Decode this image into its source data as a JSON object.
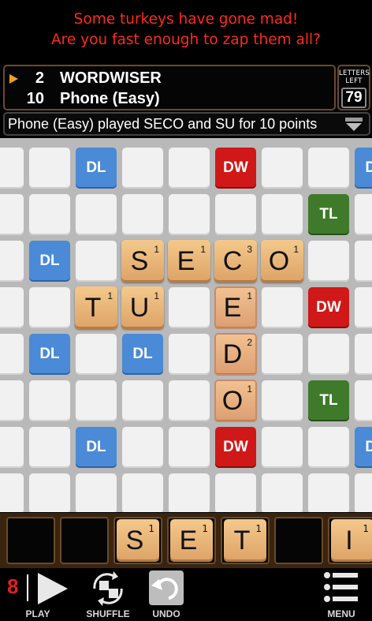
{
  "ad": {
    "line1": "Some turkeys have gone mad!",
    "line2": "Are you fast enough to zap them all?",
    "color": "#ff2a1a"
  },
  "players": [
    {
      "score": "2",
      "name": "WORDWISER",
      "active": true
    },
    {
      "score": "10",
      "name": "Phone (Easy)",
      "active": false
    }
  ],
  "letters_left": {
    "label": "LETTERS LEFT",
    "value": "79"
  },
  "last_move": "Phone (Easy) played SECO and SU for 10 points",
  "board": {
    "bonuses": [
      {
        "type": "DL",
        "col": 2,
        "row": 0
      },
      {
        "type": "DW",
        "col": 5,
        "row": 0
      },
      {
        "type": "DL",
        "col": 8,
        "row": 0
      },
      {
        "type": "TL",
        "col": 7,
        "row": 1
      },
      {
        "type": "DL",
        "col": 1,
        "row": 2
      },
      {
        "type": "DW",
        "col": 7,
        "row": 3
      },
      {
        "type": "DL",
        "col": 1,
        "row": 4
      },
      {
        "type": "DL",
        "col": 3,
        "row": 4
      },
      {
        "type": "TL",
        "col": 7,
        "row": 5
      },
      {
        "type": "DL",
        "col": 2,
        "row": 6
      },
      {
        "type": "DW",
        "col": 5,
        "row": 6
      },
      {
        "type": "DL",
        "col": 8,
        "row": 6
      }
    ],
    "tiles": [
      {
        "letter": "S",
        "value": "1",
        "col": 3,
        "row": 2,
        "highlight": false
      },
      {
        "letter": "E",
        "value": "1",
        "col": 4,
        "row": 2,
        "highlight": false
      },
      {
        "letter": "C",
        "value": "3",
        "col": 5,
        "row": 2,
        "highlight": false
      },
      {
        "letter": "O",
        "value": "1",
        "col": 6,
        "row": 2,
        "highlight": false
      },
      {
        "letter": "T",
        "value": "1",
        "col": 2,
        "row": 3,
        "highlight": false
      },
      {
        "letter": "U",
        "value": "1",
        "col": 3,
        "row": 3,
        "highlight": false
      },
      {
        "letter": "E",
        "value": "1",
        "col": 5,
        "row": 3,
        "highlight": true
      },
      {
        "letter": "D",
        "value": "2",
        "col": 5,
        "row": 4,
        "highlight": true
      },
      {
        "letter": "O",
        "value": "1",
        "col": 5,
        "row": 5,
        "highlight": true
      }
    ]
  },
  "rack": [
    {
      "letter": "",
      "value": ""
    },
    {
      "letter": "",
      "value": ""
    },
    {
      "letter": "S",
      "value": "1"
    },
    {
      "letter": "E",
      "value": "1"
    },
    {
      "letter": "T",
      "value": "1"
    },
    {
      "letter": "",
      "value": ""
    },
    {
      "letter": "I",
      "value": "1"
    }
  ],
  "toolbar": {
    "play_count": "8",
    "play_label": "PLAY",
    "shuffle_label": "SHUFFLE",
    "undo_label": "UNDO",
    "menu_label": "MENU"
  },
  "icons": {
    "expand": "chevron-down-icon",
    "play": "play-icon",
    "shuffle": "shuffle-icon",
    "undo": "undo-icon",
    "menu": "menu-icon",
    "turn": "turn-arrow-icon"
  },
  "colors": {
    "dl": "#4a8ad6",
    "dw": "#d01818",
    "tl": "#3f7a2a",
    "tile": "#e8b57a",
    "frame": "#6b4a2a"
  }
}
